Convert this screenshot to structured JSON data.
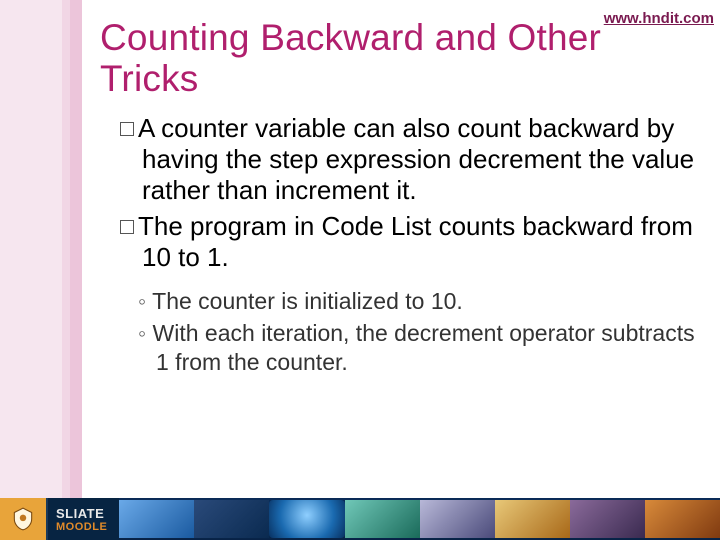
{
  "url": "www.hndit.com",
  "title": "Counting Backward and Other Tricks",
  "bullets": [
    "A counter variable can also count backward by having the step expression decrement the value rather than increment it.",
    "The program in Code List counts backward from 10 to 1."
  ],
  "subs": [
    "The counter is initialized to 10.",
    "With each iteration, the decrement operator subtracts 1 from the counter."
  ],
  "footer": {
    "brand_line1": "SLIATE",
    "brand_line2": "MOODLE"
  }
}
